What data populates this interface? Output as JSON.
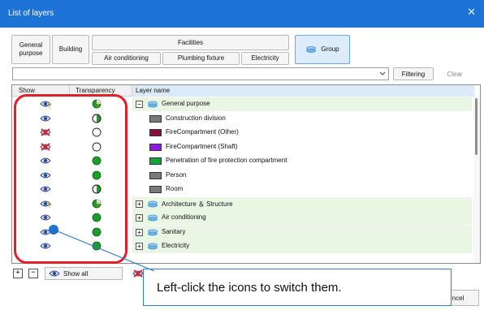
{
  "window": {
    "title": "List of layers",
    "close_glyph": "✕"
  },
  "tabs": {
    "general_purpose": "General\npurpose",
    "building": "Building",
    "facilities": "Facilities",
    "air_conditioning": "Air conditioning",
    "plumbing_fixture": "Plumbing fixture",
    "electricity": "Electricity",
    "group": "Group"
  },
  "filter": {
    "value": "",
    "filtering_label": "Filtering",
    "clear_label": "Clear"
  },
  "columns": {
    "show": "Show",
    "transparency": "Transparency",
    "layer_name": "Layer name"
  },
  "rows": [
    {
      "eye": "partial",
      "transparency": "mixed",
      "expander": "−",
      "kind": "group",
      "name": "General purpose",
      "highlight": true
    },
    {
      "eye": "visible",
      "transparency": "half",
      "kind": "layer",
      "swatch": "#7a7a7a",
      "name": "Construction division",
      "highlight": false
    },
    {
      "eye": "hidden",
      "transparency": "clear",
      "kind": "layer",
      "swatch": "#8b0f3c",
      "name": "FireCompartment (Other)",
      "highlight": false
    },
    {
      "eye": "hidden",
      "transparency": "clear",
      "kind": "layer",
      "swatch": "#8e19f0",
      "name": "FireCompartment (Shaft)",
      "highlight": false
    },
    {
      "eye": "visible",
      "transparency": "solid",
      "kind": "layer",
      "swatch": "#0aa63b",
      "name": "Penetration of fire protection compartment",
      "highlight": false
    },
    {
      "eye": "visible",
      "transparency": "solid",
      "kind": "layer",
      "swatch": "#7a7a7a",
      "name": "Person",
      "highlight": false
    },
    {
      "eye": "visible",
      "transparency": "half",
      "kind": "layer",
      "swatch": "#7a7a7a",
      "name": "Room",
      "highlight": false
    },
    {
      "eye": "partial",
      "transparency": "mixed",
      "expander": "+",
      "kind": "group",
      "name": "Architecture ＆ Structure",
      "highlight": true
    },
    {
      "eye": "visible",
      "transparency": "solid",
      "expander": "+",
      "kind": "group",
      "name": "Air conditioning",
      "highlight": true
    },
    {
      "eye": "visible",
      "transparency": "solid",
      "expander": "+",
      "kind": "group",
      "name": "Sanitary",
      "highlight": true
    },
    {
      "eye": "visible",
      "transparency": "solid",
      "expander": "+",
      "kind": "group",
      "name": "Electricity",
      "highlight": true
    }
  ],
  "bottom": {
    "expand_all": "+",
    "collapse_all": "−",
    "show_all_label": "Show all",
    "cancel_label": "ncel"
  },
  "callout": {
    "text": "Left-click the icons to switch them."
  },
  "colors": {
    "titlebar": "#1e73d6",
    "highlight_band": "#e9f6e4",
    "annotation_red": "#e11f26",
    "annotation_blue": "#2b7fd3"
  }
}
